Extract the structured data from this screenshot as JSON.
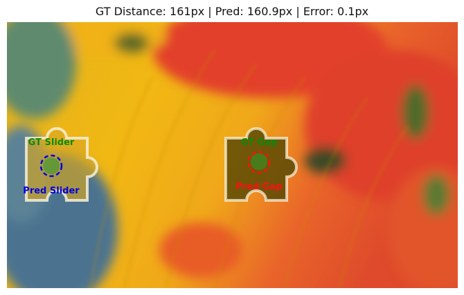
{
  "title": "GT Distance: 161px | Pred: 160.9px | Error: 0.1px",
  "labels": {
    "gt_slider": "GT Slider",
    "pred_slider": "Pred Slider",
    "gt_gap": "GT Gap",
    "pred_gap": "Pred Gap"
  },
  "colors": {
    "gt": "#0a8a0a",
    "pred_slider": "#0000e0",
    "pred_gap": "#ff1010"
  }
}
